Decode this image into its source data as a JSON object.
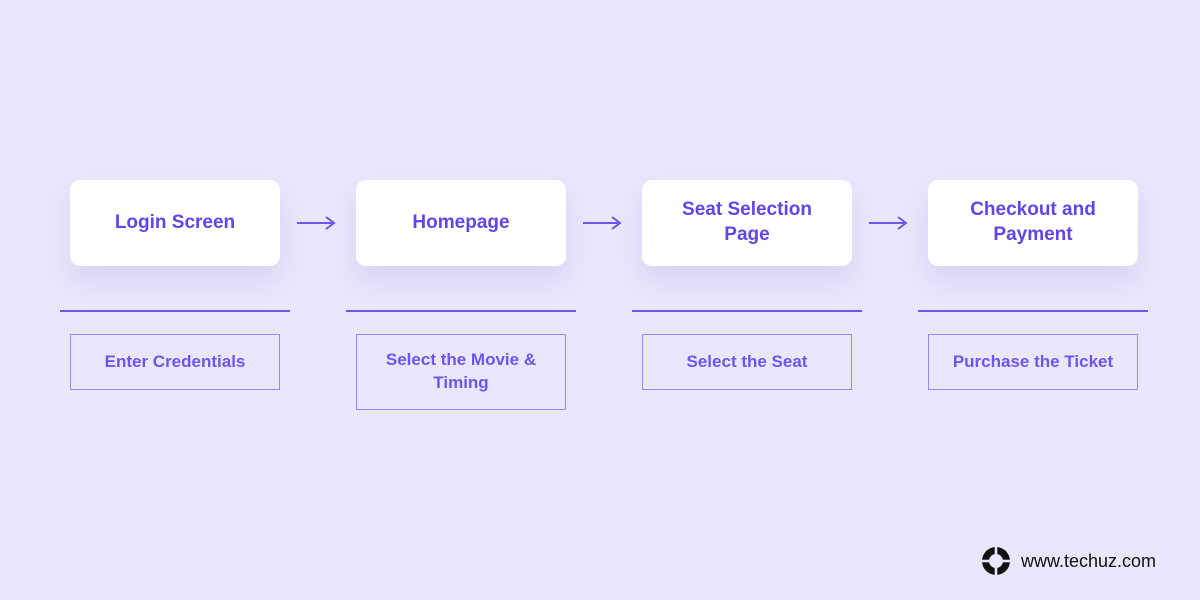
{
  "steps": [
    {
      "title": "Login Screen",
      "action": "Enter Credentials"
    },
    {
      "title": "Homepage",
      "action": "Select the Movie & Timing"
    },
    {
      "title": "Seat Selection Page",
      "action": "Select the Seat"
    },
    {
      "title": "Checkout and Payment",
      "action": "Purchase the Ticket"
    }
  ],
  "attribution": "www.techuz.com"
}
